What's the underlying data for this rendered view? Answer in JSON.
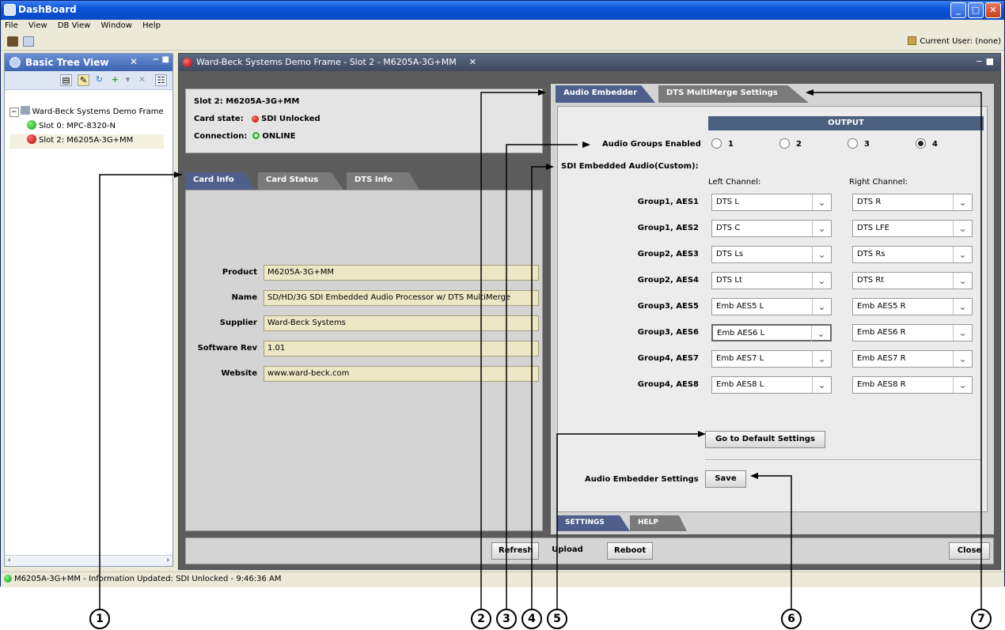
{
  "window": {
    "title": "DashBoard"
  },
  "menubar": {
    "items": [
      "File",
      "View",
      "DB View",
      "Window",
      "Help"
    ]
  },
  "toolbar": {
    "current_user": "Current User: (none)"
  },
  "left_panel": {
    "title": "Basic Tree View",
    "tree": [
      {
        "label": "Ward-Beck Systems Demo Frame",
        "status": "frame"
      },
      {
        "label": "Slot 0: MPC-8320-N",
        "status": "green"
      },
      {
        "label": "Slot 2: M6205A-3G+MM",
        "status": "red"
      }
    ]
  },
  "statusbar": {
    "text": "M6205A-3G+MM - Information Updated: SDI Unlocked - 9:46:36 AM"
  },
  "main": {
    "title": "Ward-Beck Systems Demo Frame - Slot 2 - M6205A-3G+MM",
    "slot": "Slot 2: M6205A-3G+MM",
    "card_state_label": "Card state:",
    "card_state_value": "SDI Unlocked",
    "connection_label": "Connection:",
    "connection_value": "ONLINE",
    "card_tabs": [
      "Card Info",
      "Card Status",
      "DTS Info"
    ],
    "card_info": {
      "product_label": "Product",
      "product": "M6205A-3G+MM",
      "name_label": "Name",
      "name": "SD/HD/3G SDI Embedded Audio Processor w/ DTS MultiMerge",
      "supplier_label": "Supplier",
      "supplier": "Ward-Beck Systems",
      "software_rev_label": "Software Rev",
      "software_rev": "1.01",
      "website_label": "Website",
      "website": "www.ward-beck.com"
    },
    "bottom_buttons": {
      "refresh": "Refresh",
      "upload": "Upload",
      "reboot": "Reboot",
      "close": "Close"
    }
  },
  "audio_embedder": {
    "tabs": [
      "Audio Embedder",
      "DTS MultiMerge Settings"
    ],
    "output_header": "OUTPUT",
    "groups_enabled_label": "Audio Groups Enabled",
    "radio_options": [
      "1",
      "2",
      "3",
      "4"
    ],
    "radio_selected": "4",
    "sdi_label": "SDI Embedded Audio(Custom):",
    "left_channel_header": "Left Channel:",
    "right_channel_header": "Right Channel:",
    "rows": [
      {
        "label": "Group1, AES1",
        "left": "DTS L",
        "right": "DTS R"
      },
      {
        "label": "Group1, AES2",
        "left": "DTS C",
        "right": "DTS LFE"
      },
      {
        "label": "Group2, AES3",
        "left": "DTS Ls",
        "right": "DTS Rs"
      },
      {
        "label": "Group2, AES4",
        "left": "DTS Lt",
        "right": "DTS Rt"
      },
      {
        "label": "Group3, AES5",
        "left": "Emb AES5 L",
        "right": "Emb AES5 R"
      },
      {
        "label": "Group3, AES6",
        "left": "Emb AES6 L",
        "right": "Emb AES6 R"
      },
      {
        "label": "Group4, AES7",
        "left": "Emb AES7 L",
        "right": "Emb AES7 R"
      },
      {
        "label": "Group4, AES8",
        "left": "Emb AES8 L",
        "right": "Emb AES8 R"
      }
    ],
    "default_button": "Go to Default Settings",
    "settings_label": "Audio Embedder Settings",
    "save_button": "Save",
    "subtabs": [
      "SETTINGS",
      "HELP"
    ]
  },
  "callouts": [
    "1",
    "2",
    "3",
    "4",
    "5",
    "6",
    "7"
  ],
  "colors": {
    "titlebar": "#0b53d9",
    "tab_active": "#4d5f8a",
    "output_header": "#4b5f7e",
    "field_bg": "#ece7c4"
  }
}
